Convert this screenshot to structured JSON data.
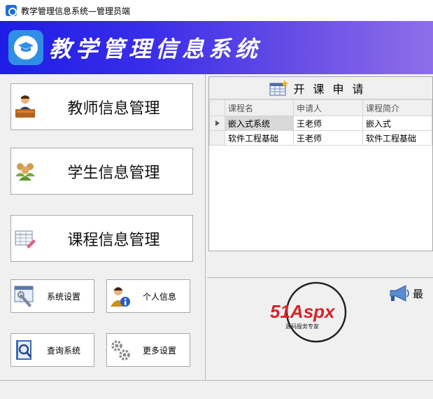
{
  "window": {
    "title": "教学管理信息系统—管理员端"
  },
  "banner": {
    "title": "教学管理信息系统"
  },
  "menu": {
    "teacher": {
      "label": "教师信息管理",
      "icon": "teacher-desk-icon"
    },
    "student": {
      "label": "学生信息管理",
      "icon": "students-group-icon"
    },
    "course": {
      "label": "课程信息管理",
      "icon": "course-grid-icon"
    },
    "settings": {
      "label": "系统设置",
      "icon": "settings-wrench-icon"
    },
    "profile": {
      "label": "个人信息",
      "icon": "user-info-icon"
    },
    "query": {
      "label": "查询系统",
      "icon": "query-book-icon"
    },
    "more": {
      "label": "更多设置",
      "icon": "gears-icon"
    }
  },
  "course_request": {
    "title": "开课申请",
    "columns": [
      "课程名",
      "申请人",
      "课程简介"
    ],
    "rows": [
      [
        "嵌入式系统",
        "王老师",
        "嵌入式"
      ],
      [
        "软件工程基础",
        "王老师",
        "软件工程基础"
      ]
    ]
  },
  "notice": {
    "text": "最"
  },
  "brand": {
    "name": "51Aspx",
    "slogan": "源码服务专家"
  },
  "colors": {
    "banner_start": "#1d1de6",
    "banner_end": "#8e6fe8",
    "brand_red": "#d8232a",
    "brand_green": "#3aa94a"
  }
}
